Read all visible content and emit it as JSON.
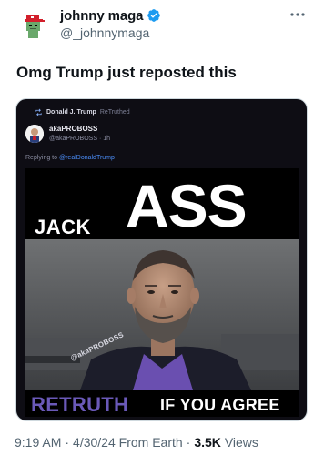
{
  "author": {
    "display_name": "johnny maga",
    "handle": "@_johnnymaga"
  },
  "tweet": {
    "text": "Omg Trump just reposted this"
  },
  "embedded": {
    "retruth_by": "Donald J. Trump",
    "retruth_suffix": "ReTruthed",
    "inner_name": "akaPROBOSS",
    "inner_meta": "@akaPROBOSS · 1h",
    "reply_prefix": "Replying to",
    "reply_mention": "@realDonaldTrump"
  },
  "meme": {
    "word_jack": "JACK",
    "word_ass": "ASS",
    "watermark": "@akaPROBOSS",
    "word_retruth": "RETRUTH",
    "word_agree": "IF YOU AGREE"
  },
  "footer": {
    "time": "9:19 AM",
    "date": "4/30/24",
    "source": "From Earth",
    "views_count": "3.5K",
    "views_label": "Views"
  },
  "colors": {
    "verified_blue": "#1d9bf0",
    "retruth_purple": "#6a59b8",
    "card_background": "#0e0d14"
  },
  "icons": [
    "verified-badge-icon",
    "more-options-icon",
    "retruth-icon"
  ]
}
